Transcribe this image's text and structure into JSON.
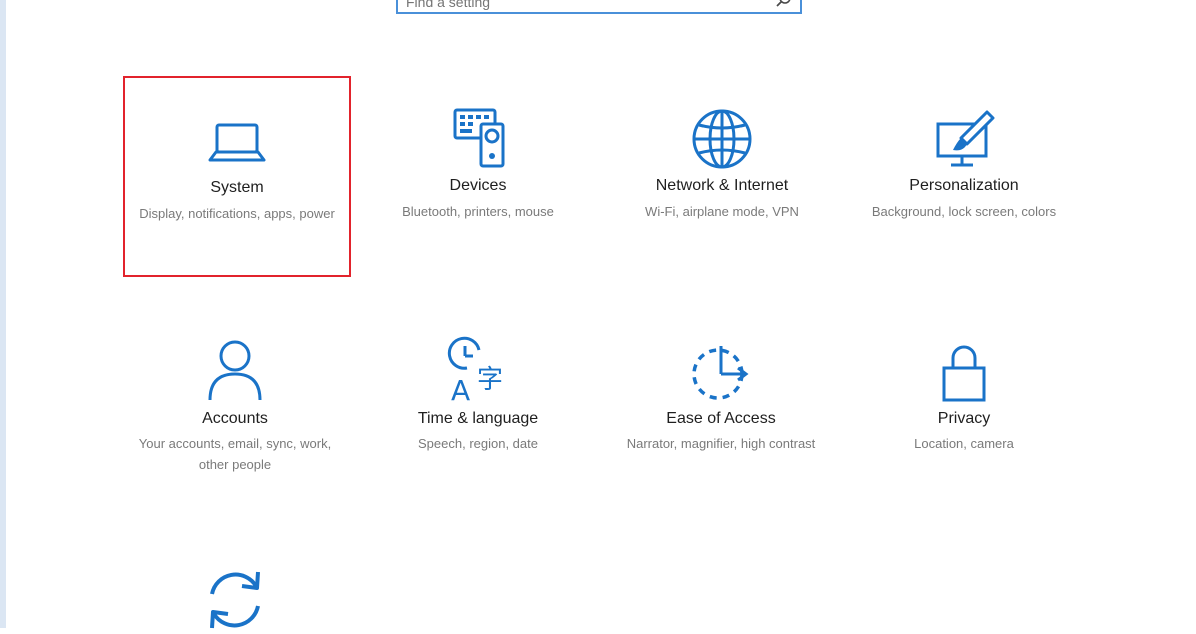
{
  "search": {
    "value": "",
    "placeholder": "Find a setting"
  },
  "tiles": [
    {
      "name": "System",
      "desc": "Display, notifications, apps, power",
      "icon": "laptop-icon",
      "selected": true
    },
    {
      "name": "Devices",
      "desc": "Bluetooth, printers, mouse",
      "icon": "devices-icon",
      "selected": false
    },
    {
      "name": "Network & Internet",
      "desc": "Wi-Fi, airplane mode, VPN",
      "icon": "globe-icon",
      "selected": false
    },
    {
      "name": "Personalization",
      "desc": "Background, lock screen, colors",
      "icon": "paintbrush-icon",
      "selected": false
    },
    {
      "name": "Accounts",
      "desc": "Your accounts, email, sync, work, other people",
      "icon": "person-icon",
      "selected": false
    },
    {
      "name": "Time & language",
      "desc": "Speech, region, date",
      "icon": "clock-language-icon",
      "selected": false
    },
    {
      "name": "Ease of Access",
      "desc": "Narrator, magnifier, high contrast",
      "icon": "ease-of-access-icon",
      "selected": false
    },
    {
      "name": "Privacy",
      "desc": "Location, camera",
      "icon": "lock-icon",
      "selected": false
    },
    {
      "name": "",
      "desc": "",
      "icon": "update-sync-icon",
      "selected": false
    }
  ],
  "colors": {
    "accent": "#1a73c8",
    "selection_border": "#e2232c",
    "search_border": "#4a90d9"
  }
}
